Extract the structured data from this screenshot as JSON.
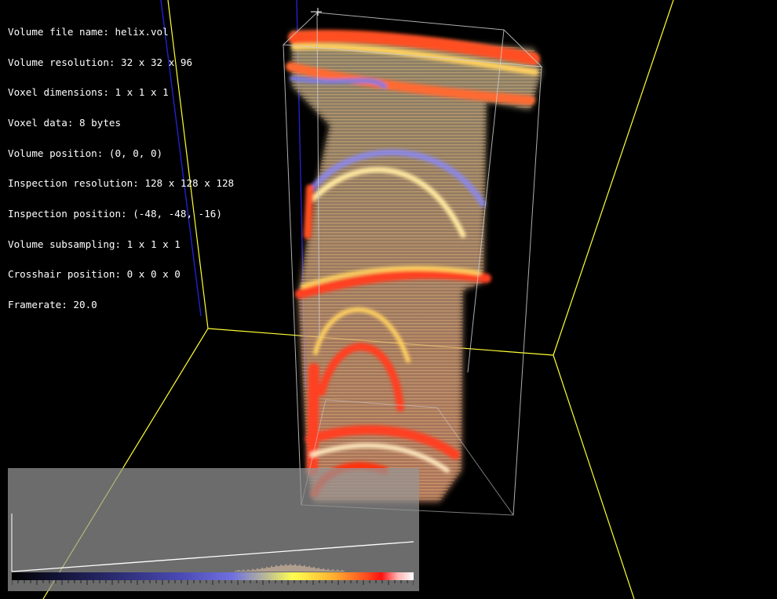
{
  "info_lines": [
    "Volume file name: helix.vol",
    "Volume resolution: 32 x 32 x 96",
    "Voxel dimensions: 1 x 1 x 1",
    "Voxel data: 8 bytes",
    "Volume position: (0, 0, 0)",
    "Inspection resolution: 128 x 128 x 128",
    "Inspection position: (-48, -48, -16)",
    "Volume subsampling: 1 x 1 x 1",
    "Crosshair position: 0 x 0 x 0",
    "Framerate: 20.0"
  ],
  "colors": {
    "background": "#000000",
    "grid_lines": "#ffff33",
    "axis_lines": "#2222cc",
    "bounding_box": "#cccccc",
    "text": "#ffffff",
    "transfer_panel": "#969696"
  },
  "transfer_function": {
    "opacity_ramp": [
      0.0,
      0.14
    ],
    "colormap": [
      "#000000",
      "#2a2a6e",
      "#7070e0",
      "#ffff50",
      "#ff5020",
      "#ff1010",
      "#ffffff"
    ]
  }
}
